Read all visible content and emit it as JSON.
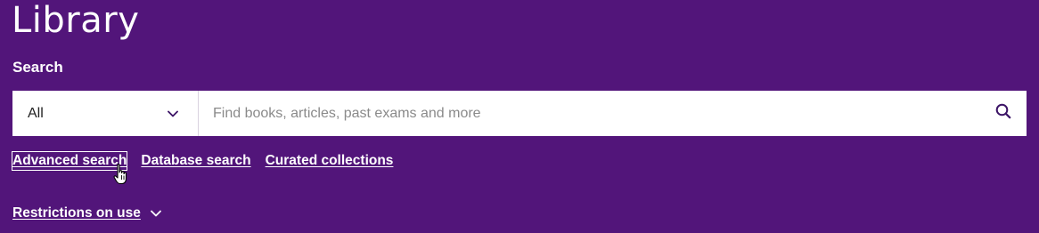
{
  "header": {
    "title": "Library"
  },
  "search": {
    "label": "Search",
    "scope_value": "All",
    "placeholder": "Find books, articles, past exams and more",
    "value": ""
  },
  "links": {
    "advanced": "Advanced search",
    "database": "Database search",
    "curated": "Curated collections"
  },
  "restrictions": {
    "label": "Restrictions on use"
  },
  "icons": {
    "scope_dropdown": "chevron-down-icon",
    "search_button": "search-icon",
    "restrictions_toggle": "chevron-down-icon",
    "cursor": "hand-pointer-cursor-icon"
  },
  "colors": {
    "background": "#52157a",
    "accent_icon": "#3c1466",
    "text": "#ffffff"
  }
}
